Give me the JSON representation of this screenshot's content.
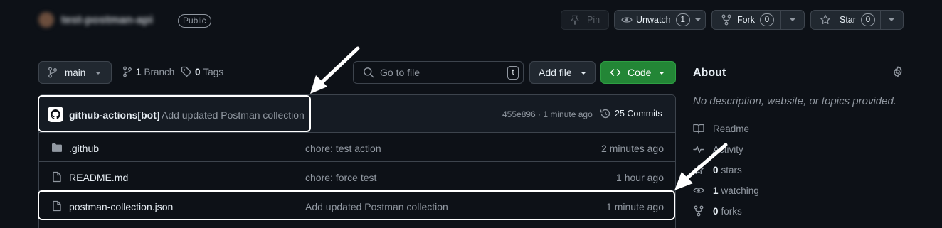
{
  "repo": {
    "name": "test-postman-api",
    "visibility": "Public"
  },
  "actions": {
    "pin_label": "Pin",
    "watch_label": "Unwatch",
    "watch_count": "1",
    "fork_label": "Fork",
    "fork_count": "0",
    "star_label": "Star",
    "star_count": "0"
  },
  "toolbar": {
    "branch": "main",
    "branch_count": "1",
    "branch_label": "Branch",
    "tag_count": "0",
    "tag_label": "Tags",
    "search_placeholder": "Go to file",
    "search_shortcut": "t",
    "add_file_label": "Add file",
    "code_label": "Code"
  },
  "latest_commit": {
    "author": "github-actions[bot]",
    "message": "Add updated Postman collection",
    "hash_time": "455e896 · 1 minute ago",
    "commits_label": "25 Commits"
  },
  "files": [
    {
      "name": ".github",
      "type": "folder",
      "message": "chore: test action",
      "time": "2 minutes ago"
    },
    {
      "name": "README.md",
      "type": "file",
      "message": "chore: force test",
      "time": "1 hour ago"
    },
    {
      "name": "postman-collection.json",
      "type": "file",
      "message": "Add updated Postman collection",
      "time": "1 minute ago"
    }
  ],
  "about": {
    "title": "About",
    "description": "No description, website, or topics provided.",
    "readme": "Readme",
    "activity": "Activity",
    "stars_count": "0",
    "stars_label": "stars",
    "watching_count": "1",
    "watching_label": "watching",
    "forks_count": "0",
    "forks_label": "forks"
  },
  "colors": {
    "background": "#0d1117",
    "border": "#3d444d",
    "code_button": "#238636",
    "annotation": "#ffffff"
  }
}
